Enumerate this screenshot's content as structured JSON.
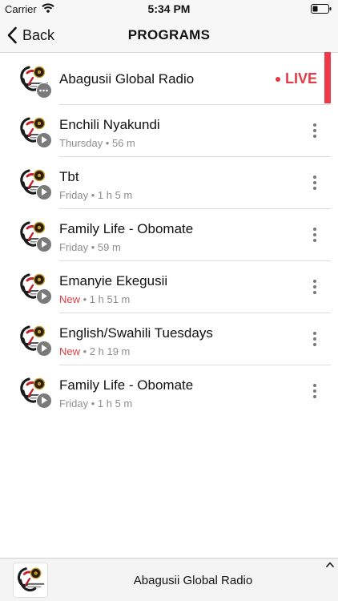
{
  "status_bar": {
    "carrier": "Carrier",
    "time": "5:34 PM"
  },
  "nav": {
    "back_label": "Back",
    "title": "PROGRAMS"
  },
  "live_row": {
    "title": "Abagusii Global Radio",
    "status": "LIVE"
  },
  "programs": [
    {
      "title": "Enchili Nyakundi",
      "tag": "",
      "meta": "Thursday • 56 m"
    },
    {
      "title": "Tbt",
      "tag": "",
      "meta": "Friday • 1 h 5 m"
    },
    {
      "title": "Family Life - Obomate",
      "tag": "",
      "meta": "Friday • 59 m"
    },
    {
      "title": "Emanyie Ekegusii",
      "tag": "New",
      "meta": " • 1 h 51 m"
    },
    {
      "title": "English/Swahili Tuesdays",
      "tag": "New",
      "meta": " • 2 h 19 m"
    },
    {
      "title": "Family Life - Obomate",
      "tag": "",
      "meta": "Friday • 1 h 5 m"
    }
  ],
  "mini_player": {
    "title": "Abagusii Global Radio"
  },
  "colors": {
    "accent_red": "#e23a45",
    "live_bar": "#ee3a48",
    "badge_gray": "#7a7a7a"
  },
  "icons": {
    "wifi": "wifi-icon",
    "battery": "battery-icon",
    "back": "chevron-left-icon",
    "more": "more-vertical-icon",
    "play": "play-icon",
    "live_badge": "ellipsis-icon",
    "expand": "chevron-up-icon"
  }
}
